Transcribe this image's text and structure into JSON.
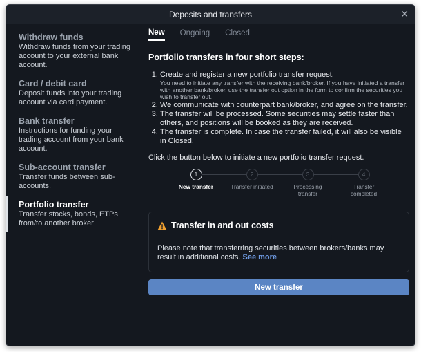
{
  "window": {
    "title": "Deposits and transfers",
    "close": "✕"
  },
  "sidebar": {
    "items": [
      {
        "title": "Withdraw funds",
        "desc": "Withdraw funds from your trading account to your external bank account."
      },
      {
        "title": "Card / debit card",
        "desc": "Deposit funds into your trading account via card payment."
      },
      {
        "title": "Bank transfer",
        "desc": "Instructions for funding your trading account from your bank account."
      },
      {
        "title": "Sub-account transfer",
        "desc": "Transfer funds between sub-accounts."
      },
      {
        "title": "Portfolio transfer",
        "desc": "Transfer stocks, bonds, ETPs from/to another broker"
      }
    ]
  },
  "tabs": [
    "New",
    "Ongoing",
    "Closed"
  ],
  "content": {
    "heading": "Portfolio transfers in four short steps:",
    "steps": [
      {
        "text": "Create and register a new portfolio transfer request.",
        "sub": "You need to initiate any transfer with the receiving bank/broker. If you have initiated a transfer with another bank/broker, use the transfer out option in the form to confirm the securities you wish to transfer out."
      },
      {
        "text": "We communicate with counterpart bank/broker, and agree on the transfer."
      },
      {
        "text": "The transfer will be processed. Some securities may settle faster than others, and positions will be booked as they are received."
      },
      {
        "text": "The transfer is complete. In case the transfer failed, it will also be visible in Closed."
      }
    ],
    "intro": "Click the button below to initiate a new portfolio transfer request."
  },
  "stepper": [
    {
      "num": "1",
      "label": "New transfer"
    },
    {
      "num": "2",
      "label": "Transfer initiated"
    },
    {
      "num": "3",
      "label": "Processing transfer"
    },
    {
      "num": "4",
      "label": "Transfer completed"
    }
  ],
  "costs": {
    "icon": "warning-icon",
    "title": "Transfer in and out costs",
    "text": "Please note that transferring securities between brokers/banks may result in additional costs.",
    "link": "See more"
  },
  "button": {
    "label": "New transfer"
  },
  "colors": {
    "background": "#14181f",
    "accent": "#5b85c4",
    "link": "#6f9be3",
    "warning": "#f0a030"
  }
}
